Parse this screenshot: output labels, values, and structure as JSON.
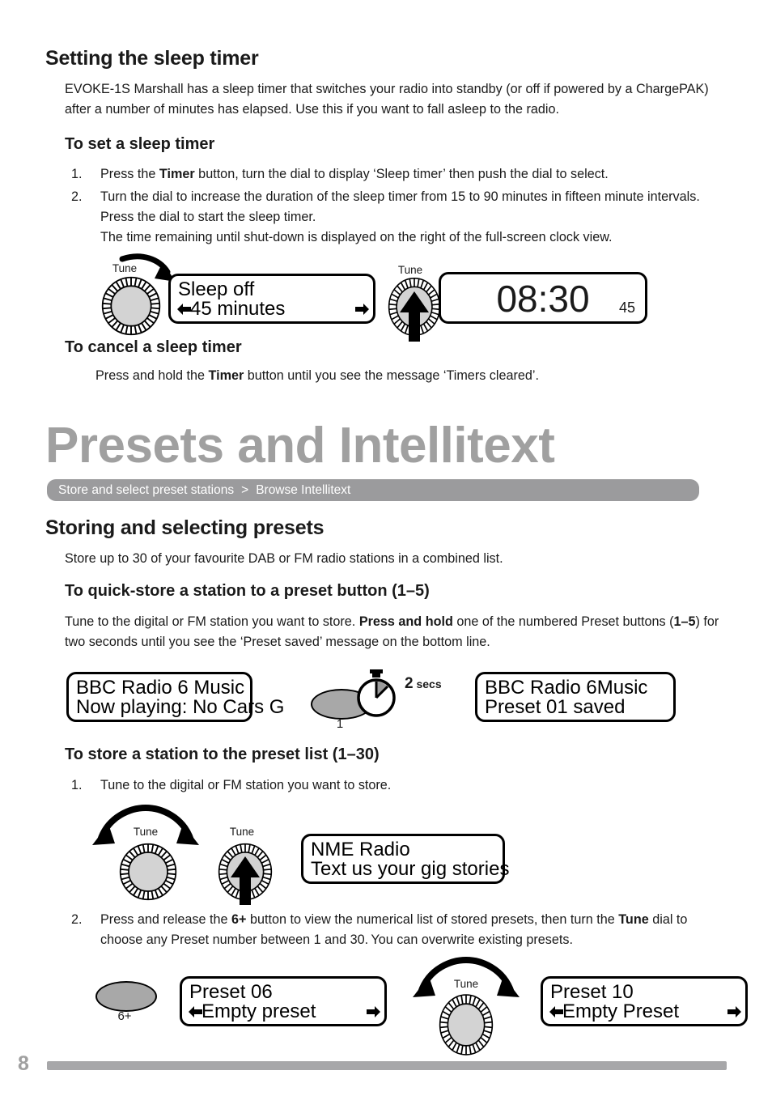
{
  "document": {
    "page_number": "8"
  },
  "sleep_timer": {
    "heading": "Setting the sleep timer",
    "intro": "EVOKE-1S Marshall has a sleep timer that switches your radio into standby (or off if powered by a ChargePAK) after a number of minutes has elapsed. Use this if you want to fall asleep to the radio.",
    "set_heading": "To set a sleep timer",
    "steps": [
      {
        "num": "1.",
        "parts": [
          {
            "text": "Press the ",
            "bold": false
          },
          {
            "text": "Timer",
            "bold": true
          },
          {
            "text": " button, turn the dial to display ‘Sleep timer’ then push the dial to select.",
            "bold": false
          }
        ]
      },
      {
        "num": "2.",
        "parts": [
          {
            "text": "Turn the dial to increase the duration of the sleep timer from 15 to 90 minutes in fifteen minute intervals. Press the dial to start the sleep timer.",
            "bold": false
          },
          {
            "text": "BREAK",
            "bold": false
          },
          {
            "text": "The time remaining until shut-down is displayed on the right of the full-screen clock view.",
            "bold": false
          }
        ]
      }
    ],
    "cancel_heading": "To cancel a sleep timer",
    "cancel_text_parts": [
      {
        "text": "Press and hold the ",
        "bold": false
      },
      {
        "text": "Timer",
        "bold": true
      },
      {
        "text": " button until you see the message ‘Timers cleared’.",
        "bold": false
      }
    ],
    "diagram": {
      "dial1_label": "Tune",
      "dial2_label": "Tune",
      "display1_line1": "Sleep off",
      "display1_line2": "45 minutes",
      "display1_has_left_arrow": true,
      "display1_has_right_arrow": true,
      "clock_time": "08:30",
      "clock_minutes_remaining": "45"
    }
  },
  "presets": {
    "chapter_title": "Presets and Intellitext",
    "breadcrumb": {
      "item1": "Store and select preset stations",
      "separator": ">",
      "item2": "Browse Intellitext"
    },
    "storing_heading": "Storing and selecting presets",
    "storing_intro": "Store up to 30 of your favourite DAB or FM radio stations in a combined list.",
    "quick_store_heading": "To quick-store a station to a preset button (1–5)",
    "quick_store_text_parts": [
      {
        "text": "Tune to the digital or FM station you want to store. ",
        "bold": false
      },
      {
        "text": "Press and hold",
        "bold": true
      },
      {
        "text": " one of the numbered Preset buttons (",
        "bold": false
      },
      {
        "text": "1–5",
        "bold": true
      },
      {
        "text": ") for two seconds until you see the ‘Preset saved’ message on the bottom line.",
        "bold": false
      }
    ],
    "quick_store_diagram": {
      "display_before_line1": "BBC Radio 6 Music",
      "display_before_line2": "Now playing: No Cars G",
      "preset_button_label": "1",
      "hold_duration_value": "2",
      "hold_duration_unit": "secs",
      "display_after_line1": "BBC Radio 6Music",
      "display_after_line2": "Preset 01 saved"
    },
    "preset_list_heading": "To store a station to the preset list (1–30)",
    "preset_list_steps": [
      {
        "num": "1.",
        "parts": [
          {
            "text": "Tune to the digital or FM station you want to store.",
            "bold": false
          }
        ]
      },
      {
        "num": "2.",
        "parts": [
          {
            "text": "Press and release the ",
            "bold": false
          },
          {
            "text": "6+",
            "bold": true
          },
          {
            "text": " button to view the numerical list of stored presets, then turn the ",
            "bold": false
          },
          {
            "text": "Tune",
            "bold": true
          },
          {
            "text": " dial to choose any Preset number between 1 and 30. You can overwrite existing presets.",
            "bold": false
          }
        ]
      }
    ],
    "step1_diagram": {
      "dial1_label": "Tune",
      "dial2_label": "Tune",
      "display_line1": "NME Radio",
      "display_line2": "Text us your gig stories"
    },
    "step2_diagram": {
      "preset_button_label": "6+",
      "display1_line1": "Preset 06",
      "display1_line2": "Empty preset",
      "dial_label": "Tune",
      "display2_line1": "Preset 10",
      "display2_line2": "Empty Preset"
    }
  },
  "colors": {
    "chapter_gray": "#a0a0a0",
    "breadcrumb_gray": "#9b9b9d",
    "footer_gray": "#a7a7a9",
    "knob_fill": "#d3d3d3",
    "button_fill": "#a8a8a8",
    "text_black": "#1a1a1a"
  }
}
